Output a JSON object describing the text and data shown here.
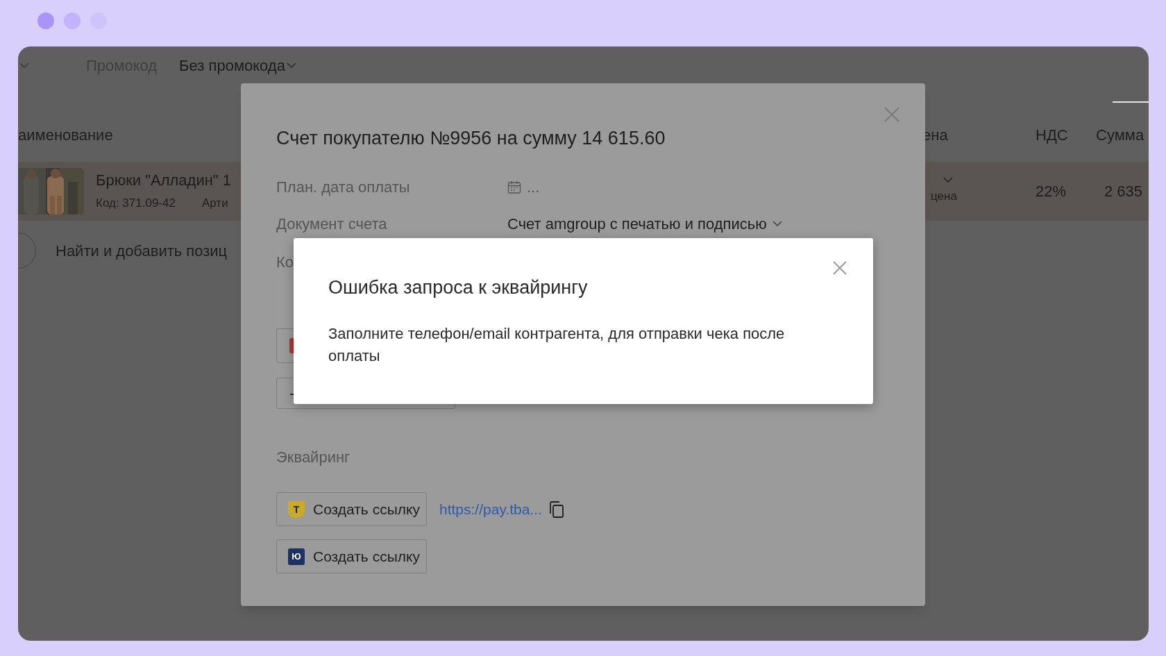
{
  "page": {
    "promo_label": "Промокод",
    "promo_value": "Без промокода",
    "columns_left": [
      "аименование"
    ],
    "columns_right": [
      "ена",
      "НДС",
      "Сумма"
    ],
    "row": {
      "name": "Брюки \"Алладин\" 1",
      "code": "Код: 371.09-42",
      "article": "Арти",
      "price_note": "цена",
      "vat": "22%",
      "sum": "2 635"
    },
    "add_item": "Найти и добавить позиц"
  },
  "invoice_modal": {
    "title": "Счет покупателю №9956 на сумму 14 615.60",
    "fields": [
      {
        "label": "План. дата оплаты",
        "value": "...",
        "kind": "date"
      },
      {
        "label": "Документ счета",
        "value": "Счет amgroup с печатью и подписью",
        "kind": "select"
      }
    ],
    "partial_label": "Ко",
    "partial_field_value": "-",
    "acquiring_heading": "Эквайринг",
    "acquiring": [
      {
        "kind": "tbank",
        "mark": "T",
        "button": "Создать ссылку",
        "link": "https://pay.tba..."
      },
      {
        "kind": "yoo",
        "mark": "Ю",
        "button": "Создать ссылку"
      }
    ]
  },
  "error_dialog": {
    "title": "Ошибка запроса к эквайрингу",
    "message": "Заполните телефон/email контрагента, для отправки чека после оплаты"
  }
}
